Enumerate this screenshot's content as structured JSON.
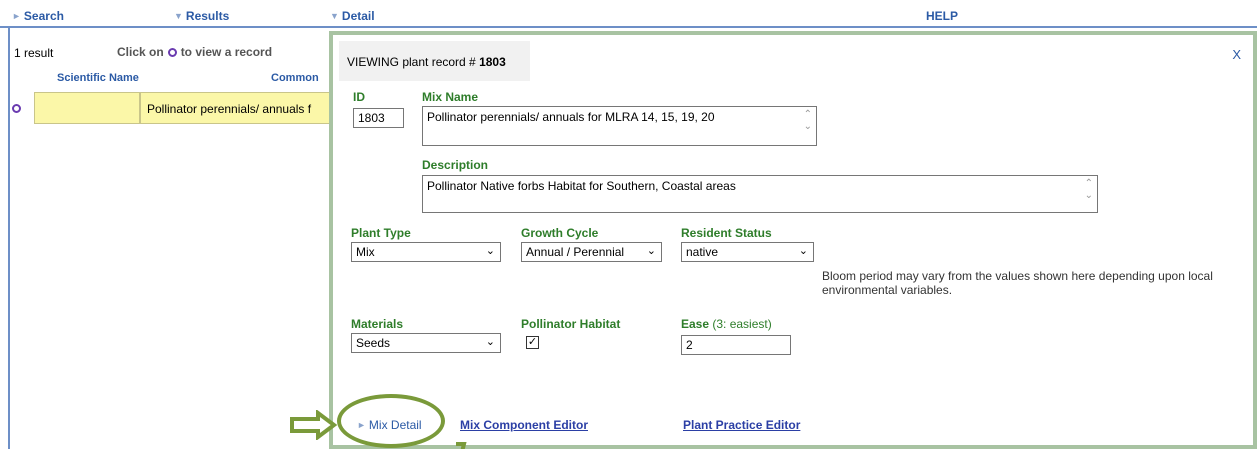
{
  "topbar": {
    "search": "Search",
    "results": "Results",
    "detail": "Detail",
    "help": "HELP"
  },
  "results": {
    "count": "1 result",
    "click_on_prefix": "Click on",
    "click_on_suffix": "to view a record",
    "col_scientific": "Scientific Name",
    "col_common": "Common",
    "row_common": "Pollinator perennials/ annuals f"
  },
  "panel": {
    "viewing_prefix": "VIEWING plant record #",
    "record_id": "1803",
    "close": "X",
    "id_label": "ID",
    "id_value": "1803",
    "mixname_label": "Mix Name",
    "mixname_value": "Pollinator perennials/ annuals for MLRA 14, 15, 19, 20",
    "description_label": "Description",
    "description_value": "Pollinator Native forbs Habitat for Southern, Coastal areas",
    "planttype_label": "Plant Type",
    "planttype_value": "Mix",
    "growthcycle_label": "Growth Cycle",
    "growthcycle_value": "Annual / Perennial",
    "resident_label": "Resident Status",
    "resident_value": "native",
    "bloom_note": "Bloom period may vary from the values shown here depending upon local environmental variables.",
    "materials_label": "Materials",
    "materials_value": "Seeds",
    "pollinator_label": "Pollinator Habitat",
    "pollinator_checked": "✓",
    "ease_label": "Ease",
    "ease_hint": "(3: easiest)",
    "ease_value": "2",
    "mix_detail": "Mix Detail",
    "mix_component_editor": "Mix Component Editor",
    "plant_practice_editor": "Plant Practice Editor"
  },
  "colors": {
    "accent_blue": "#2b5aa5",
    "label_green": "#2e7d2a",
    "panel_border": "#a8c3a2",
    "highlight_yellow": "#fbf7a8",
    "annotation_olive": "#7a9a3a"
  }
}
